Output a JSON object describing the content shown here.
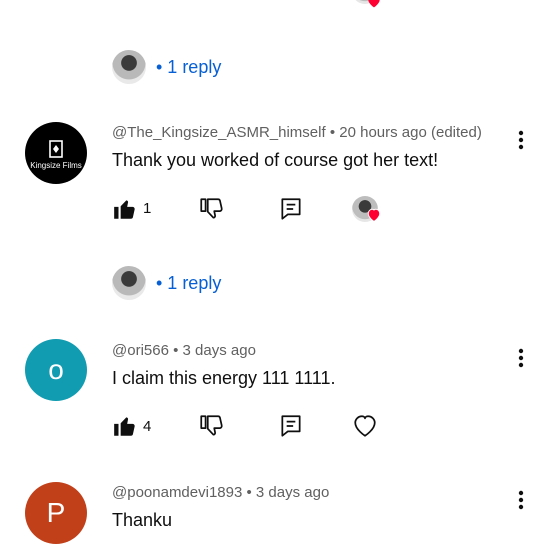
{
  "replies": {
    "first_link": "• 1 reply",
    "second_link": "• 1 reply"
  },
  "comments": [
    {
      "avatar_text": "Kingsize Films",
      "handle": "@The_Kingsize_ASMR_himself",
      "time": "• 20 hours ago (edited)",
      "text": "Thank you worked of course got her text!",
      "likes": "1"
    },
    {
      "avatar_letter": "o",
      "avatar_color": "#119cb1",
      "handle": "@ori566",
      "time": "• 3 days ago",
      "text": "I claim this energy 111 1111.",
      "likes": "4"
    },
    {
      "avatar_letter": "P",
      "avatar_color": "#c1401a",
      "handle": "@poonamdevi1893",
      "time": "• 3 days ago",
      "text": "Thanku"
    }
  ],
  "icons": {
    "like": "thumb-up-icon",
    "dislike": "thumb-down-icon",
    "reply": "comment-icon",
    "more": "more-vert-icon",
    "heart": "heart-icon",
    "creator_heart": "red-heart-icon"
  }
}
